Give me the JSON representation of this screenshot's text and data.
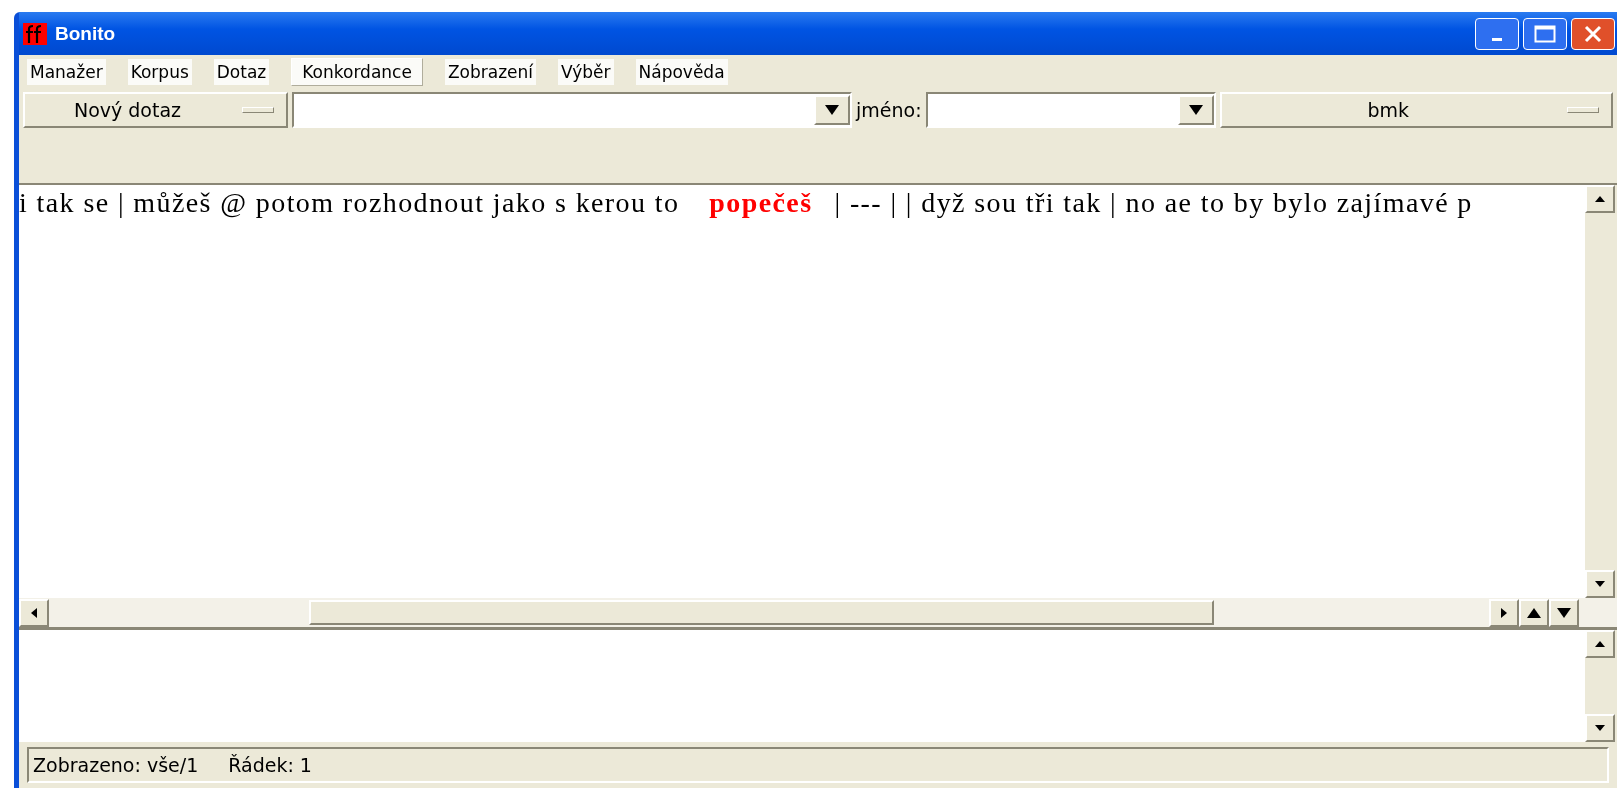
{
  "window": {
    "title": "Bonito"
  },
  "menu": [
    {
      "label": "Manažer",
      "selected": false
    },
    {
      "label": "Korpus",
      "selected": false
    },
    {
      "label": "Dotaz",
      "selected": false
    },
    {
      "label": "Konkordance",
      "selected": true
    },
    {
      "label": "Zobrazení",
      "selected": false
    },
    {
      "label": "Výběr",
      "selected": false
    },
    {
      "label": "Nápověda",
      "selected": false
    }
  ],
  "toolbar": {
    "query_button": "Nový dotaz",
    "name_label": "jméno:",
    "bookmark_button": "bmk"
  },
  "concordance": {
    "left": "i tak se | můžeš @ potom rozhodnout jako s kerou to",
    "keyword": "popečeš",
    "right": "| --- | | dyž sou tři tak | no ae to by bylo zajímavé p"
  },
  "status_bar": [
    "Zobrazeno: vše/1",
    "Řádek: 1"
  ]
}
